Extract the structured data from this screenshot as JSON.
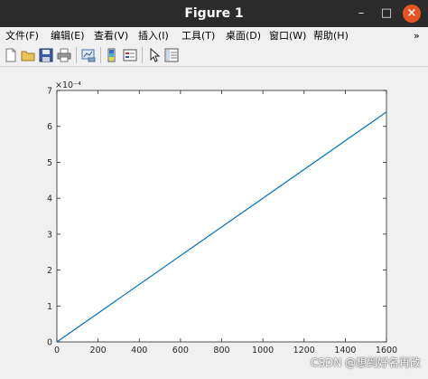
{
  "window": {
    "title": "Figure 1"
  },
  "window_controls": {
    "minimize": "–",
    "maximize": "□",
    "close": "×"
  },
  "menu": {
    "items": [
      {
        "label": "文件(F)"
      },
      {
        "label": "编辑(E)"
      },
      {
        "label": "查看(V)"
      },
      {
        "label": "插入(I)"
      },
      {
        "label": "工具(T)"
      },
      {
        "label": "桌面(D)"
      },
      {
        "label": "窗口(W)"
      },
      {
        "label": "帮助(H)"
      }
    ],
    "overflow": "»"
  },
  "toolbar": {
    "buttons": [
      {
        "icon": "new-figure-icon"
      },
      {
        "icon": "open-file-icon"
      },
      {
        "icon": "save-icon"
      },
      {
        "icon": "print-icon"
      },
      {
        "icon": "link-plot-icon"
      },
      {
        "icon": "insert-colorbar-icon"
      },
      {
        "icon": "insert-legend-icon"
      },
      {
        "icon": "select-arrow-icon"
      },
      {
        "icon": "property-inspector-icon"
      }
    ]
  },
  "chart_data": {
    "type": "line",
    "title": "",
    "xlabel": "",
    "ylabel": "",
    "xlim": [
      0,
      1600
    ],
    "ylim": [
      0,
      7
    ],
    "y_exponent_label": "×10⁻⁴",
    "x_ticks": [
      "0",
      "200",
      "400",
      "600",
      "800",
      "1000",
      "1200",
      "1400",
      "1600"
    ],
    "y_ticks": [
      "0",
      "1",
      "2",
      "3",
      "4",
      "5",
      "6",
      "7"
    ],
    "grid": false,
    "series": [
      {
        "color": "#0072bd",
        "x": [
          0,
          1600
        ],
        "y": [
          0,
          6.4
        ]
      }
    ]
  },
  "watermark": "CSDN @想到好名再改"
}
